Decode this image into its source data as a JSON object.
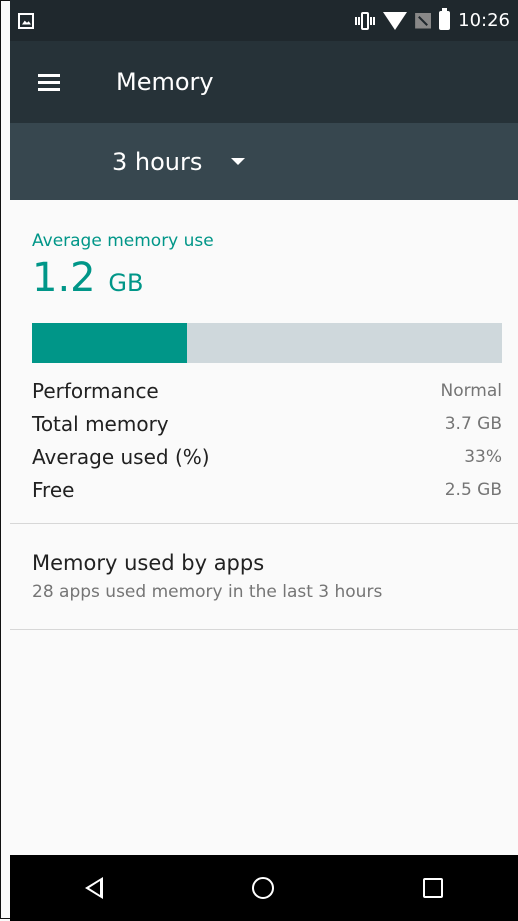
{
  "status": {
    "time": "10:26"
  },
  "app": {
    "title": "Memory"
  },
  "filter": {
    "period": "3 hours"
  },
  "summary": {
    "label": "Average memory use",
    "value": "1.2",
    "unit": "GB",
    "usage_fraction": 0.33
  },
  "metrics": [
    {
      "label": "Performance",
      "value": "Normal"
    },
    {
      "label": "Total memory",
      "value": "3.7 GB"
    },
    {
      "label": "Average used (%)",
      "value": "33%"
    },
    {
      "label": "Free",
      "value": "2.5 GB"
    }
  ],
  "apps_section": {
    "title": "Memory used by apps",
    "subtitle": "28 apps used memory in the last 3 hours"
  },
  "colors": {
    "accent": "#009688",
    "appbar": "#263238",
    "filterbar": "#37474f"
  }
}
